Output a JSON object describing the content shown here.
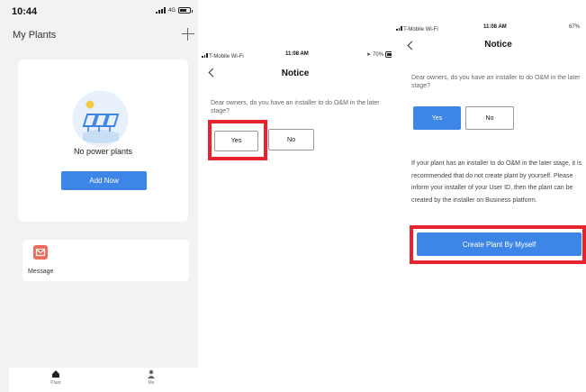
{
  "screen1": {
    "status": {
      "time": "10:44",
      "network": "4G"
    },
    "title": "My Plants",
    "empty_text": "No power plants",
    "add_button": "Add Now",
    "message_label": "Message",
    "tabs": [
      {
        "label": "Plant",
        "icon": "home-icon"
      },
      {
        "label": "Me",
        "icon": "person-icon"
      }
    ],
    "colors": {
      "accent": "#3d85e6",
      "message_icon": "#ef6b5b"
    }
  },
  "screen2": {
    "status": {
      "carrier": "T-Mobile Wi-Fi",
      "time": "11:08 AM",
      "battery": "70%"
    },
    "title": "Notice",
    "question": "Dear owners, do you have an installer to do O&M in the later stage?",
    "yes_label": "Yes",
    "no_label": "No",
    "highlight_color": "#e8232f"
  },
  "screen3": {
    "status": {
      "carrier": "T-Mobile Wi-Fi",
      "time": "11:08 AM",
      "battery": "67%"
    },
    "title": "Notice",
    "question": "Dear owners, do you have an installer to do O&M in the later stage?",
    "yes_label": "Yes",
    "no_label": "No",
    "recommendation": "If your plant has an installer to do O&M in the later stage, it is recommended that do not create plant by yourself. Please inform your installer of your User ID, then the plant can be created by the installer on Business platform.",
    "create_button": "Create Plant By Myself",
    "highlight_color": "#e8232f"
  }
}
